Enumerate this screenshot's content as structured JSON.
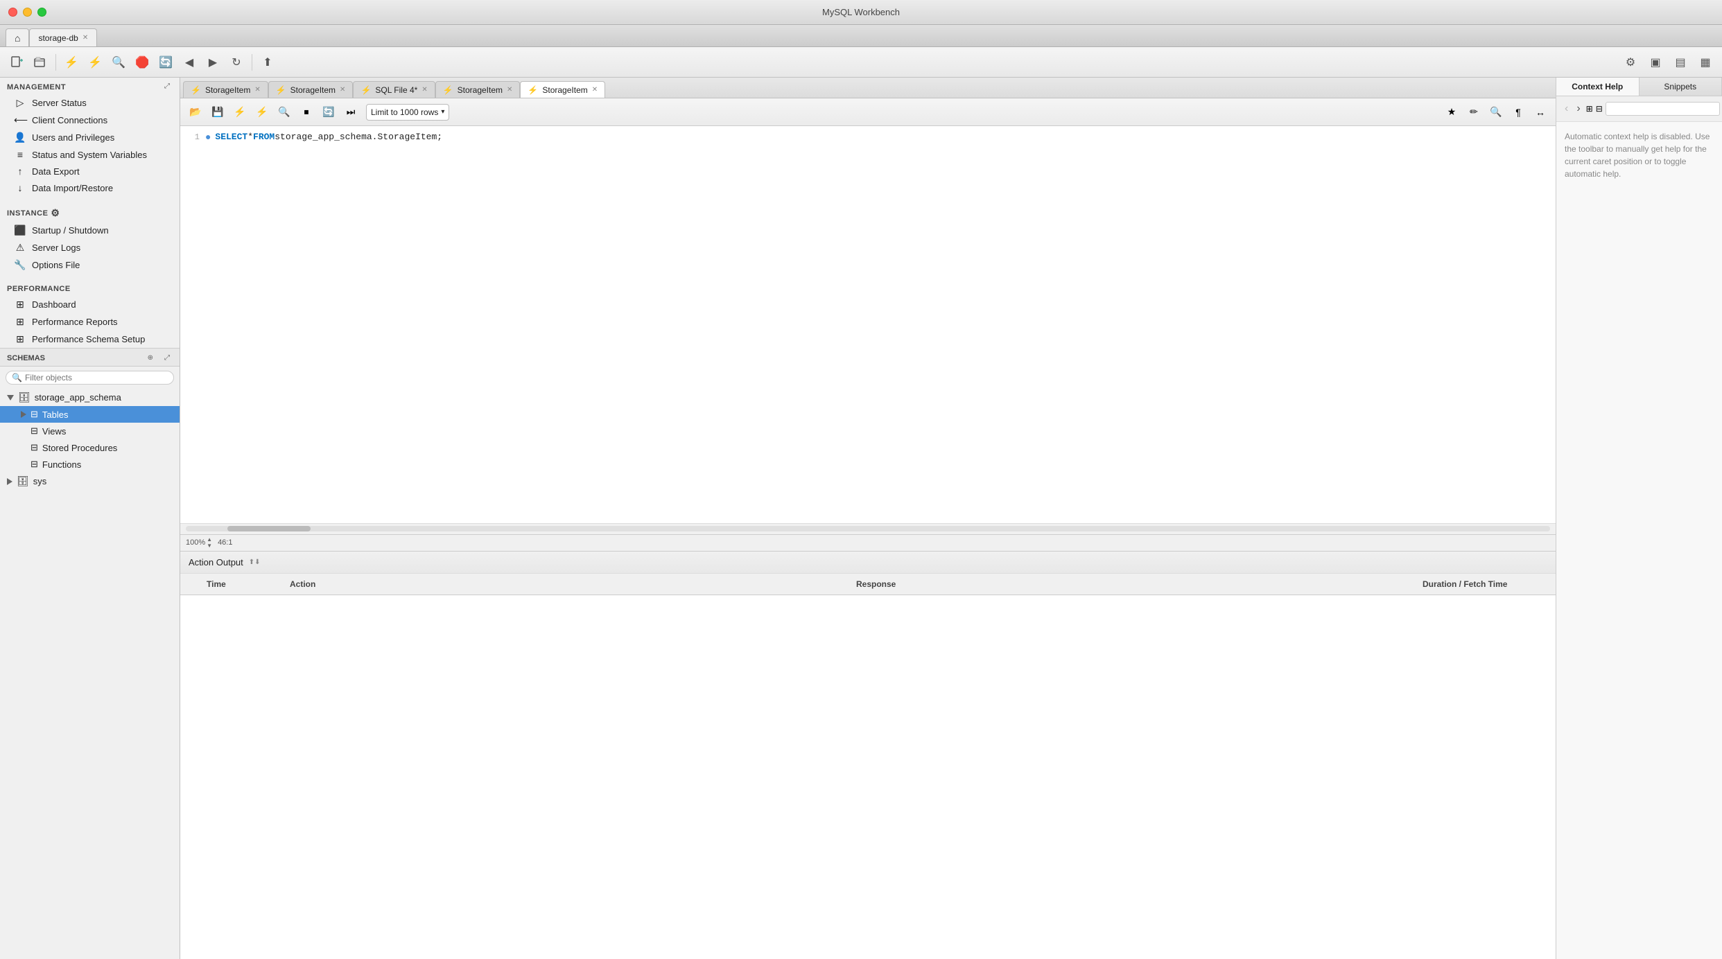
{
  "app": {
    "title": "MySQL Workbench",
    "window_tab": "storage-db"
  },
  "toolbar": {
    "buttons": [
      "new-sql",
      "open-sql",
      "save-sql",
      "reconnect",
      "create-schema",
      "create-table",
      "create-view",
      "create-procedure",
      "create-function",
      "inspect"
    ],
    "right_icon": "settings"
  },
  "query_tabs": [
    {
      "label": "StorageItem",
      "active": false,
      "closable": true
    },
    {
      "label": "StorageItem",
      "active": false,
      "closable": true
    },
    {
      "label": "SQL File 4*",
      "active": false,
      "closable": true
    },
    {
      "label": "StorageItem",
      "active": false,
      "closable": true
    },
    {
      "label": "StorageItem",
      "active": true,
      "closable": true
    }
  ],
  "sql_toolbar": {
    "limit_label": "Limit to 1000 rows"
  },
  "editor": {
    "line1": {
      "num": "1",
      "content_select": "SELECT",
      "content_star": " * ",
      "content_from": "FROM",
      "content_table": " storage_app_schema.StorageItem;"
    }
  },
  "statusbar": {
    "zoom": "100%",
    "position": "46:1"
  },
  "action_output": {
    "label": "Action Output",
    "columns": [
      "",
      "Time",
      "Action",
      "Response",
      "Duration / Fetch Time"
    ]
  },
  "right_panel": {
    "tabs": [
      "Context Help",
      "Snippets"
    ],
    "active_tab": "Context Help",
    "nav_prev": "‹",
    "nav_next": "›",
    "help_text": "Automatic context help is disabled. Use the toolbar to manually get help for the current caret position or to toggle automatic help."
  },
  "sidebar": {
    "management_header": "MANAGEMENT",
    "management_items": [
      {
        "id": "server-status",
        "label": "Server Status",
        "icon": "▷"
      },
      {
        "id": "client-connections",
        "label": "Client Connections",
        "icon": "⟂"
      },
      {
        "id": "users-and-privileges",
        "label": "Users and Privileges",
        "icon": "👤"
      },
      {
        "id": "status-and-system-variables",
        "label": "Status and System Variables",
        "icon": "≡"
      },
      {
        "id": "data-export",
        "label": "Data Export",
        "icon": "↑"
      },
      {
        "id": "data-import",
        "label": "Data Import/Restore",
        "icon": "↓"
      }
    ],
    "instance_header": "INSTANCE",
    "instance_items": [
      {
        "id": "startup-shutdown",
        "label": "Startup / Shutdown",
        "icon": "⬛"
      },
      {
        "id": "server-logs",
        "label": "Server Logs",
        "icon": "⚠"
      },
      {
        "id": "options-file",
        "label": "Options File",
        "icon": "🔧"
      }
    ],
    "performance_header": "PERFORMANCE",
    "performance_items": [
      {
        "id": "dashboard",
        "label": "Dashboard",
        "icon": "⊞"
      },
      {
        "id": "performance-reports",
        "label": "Performance Reports",
        "icon": "⊞"
      },
      {
        "id": "performance-schema-setup",
        "label": "Performance Schema Setup",
        "icon": "⊞"
      }
    ],
    "schemas_header": "SCHEMAS",
    "schemas_search_placeholder": "Filter objects",
    "schemas": [
      {
        "name": "storage_app_schema",
        "expanded": true,
        "children": [
          {
            "id": "tables",
            "label": "Tables",
            "selected": true
          },
          {
            "id": "views",
            "label": "Views"
          },
          {
            "id": "stored-procedures",
            "label": "Stored Procedures"
          },
          {
            "id": "functions",
            "label": "Functions"
          }
        ]
      },
      {
        "name": "sys",
        "expanded": false,
        "children": []
      }
    ]
  }
}
